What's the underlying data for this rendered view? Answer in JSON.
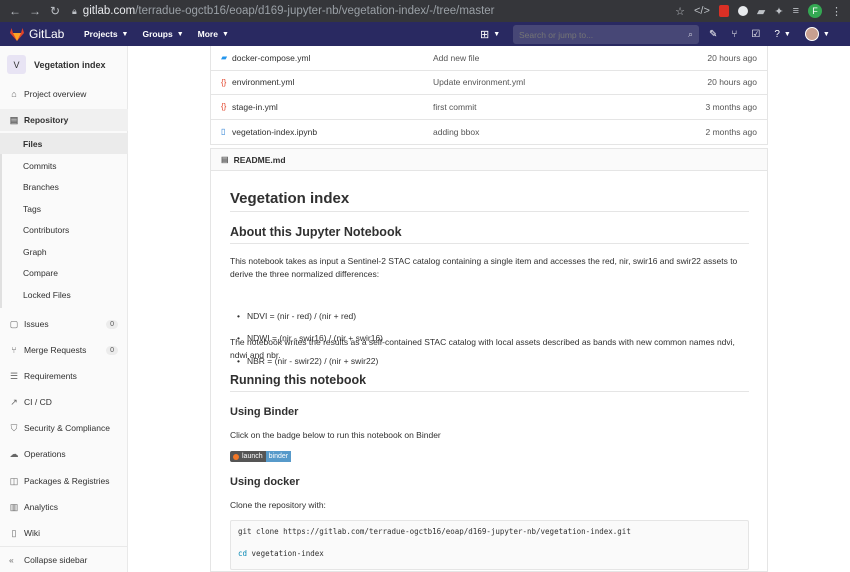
{
  "browser": {
    "url_host": "gitlab.com",
    "url_path": "/terradue-ogctb16/eoap/d169-jupyter-nb/vegetation-index/-/tree/master",
    "profile_initial": "F"
  },
  "header": {
    "logo_text": "GitLab",
    "nav": [
      "Projects",
      "Groups",
      "More"
    ],
    "search_placeholder": "Search or jump to..."
  },
  "sidebar": {
    "project_initial": "V",
    "project_name": "Vegetation index",
    "items": {
      "overview": "Project overview",
      "repository": "Repository",
      "issues": "Issues",
      "issues_count": "0",
      "merge_requests": "Merge Requests",
      "merge_requests_count": "0",
      "requirements": "Requirements",
      "cicd": "CI / CD",
      "security": "Security & Compliance",
      "operations": "Operations",
      "packages": "Packages & Registries",
      "analytics": "Analytics",
      "wiki": "Wiki"
    },
    "repo_sub": [
      "Files",
      "Commits",
      "Branches",
      "Tags",
      "Contributors",
      "Graph",
      "Compare",
      "Locked Files"
    ],
    "collapse_label": "Collapse sidebar"
  },
  "files": [
    {
      "name": "docker-compose.yml",
      "message": "Add new file",
      "time": "20 hours ago",
      "icon": "docker-icon"
    },
    {
      "name": "environment.yml",
      "message": "Update environment.yml",
      "time": "20 hours ago",
      "icon": "yaml-icon"
    },
    {
      "name": "stage-in.yml",
      "message": "first commit",
      "time": "3 months ago",
      "icon": "yaml-icon"
    },
    {
      "name": "vegetation-index.ipynb",
      "message": "adding bbox",
      "time": "2 months ago",
      "icon": "file-icon"
    }
  ],
  "readme": {
    "filename": "README.md",
    "title": "Vegetation index",
    "about_heading": "About this Jupyter Notebook",
    "about_p1": "This notebook takes as input a Sentinel-2 STAC catalog containing a single item and accesses the red, nir, swir16 and swir22 assets to derive the three normalized differences:",
    "bullets": [
      "NDVI = (nir - red) / (nir + red)",
      "NDWI = (nir - swir16) / (nir + swir16)",
      "NBR = (nir - swir22) / (nir + swir22)"
    ],
    "about_p2": "The notebook writes the results as a self-contained STAC catalog with local assets described as bands with new common names ndvi, ndwi and nbr.",
    "running_heading": "Running this notebook",
    "binder_heading": "Using Binder",
    "binder_p": "Click on the badge below to run this notebook on Binder",
    "badge_left": "launch",
    "badge_right": "binder",
    "docker_heading": "Using docker",
    "docker_p": "Clone the repository with:",
    "code_line1": "git clone https://gitlab.com/terradue-ogctb16/eoap/d169-jupyter-nb/vegetation-index.git",
    "code_cd": "cd",
    "code_line2_rest": " vegetation-index"
  }
}
